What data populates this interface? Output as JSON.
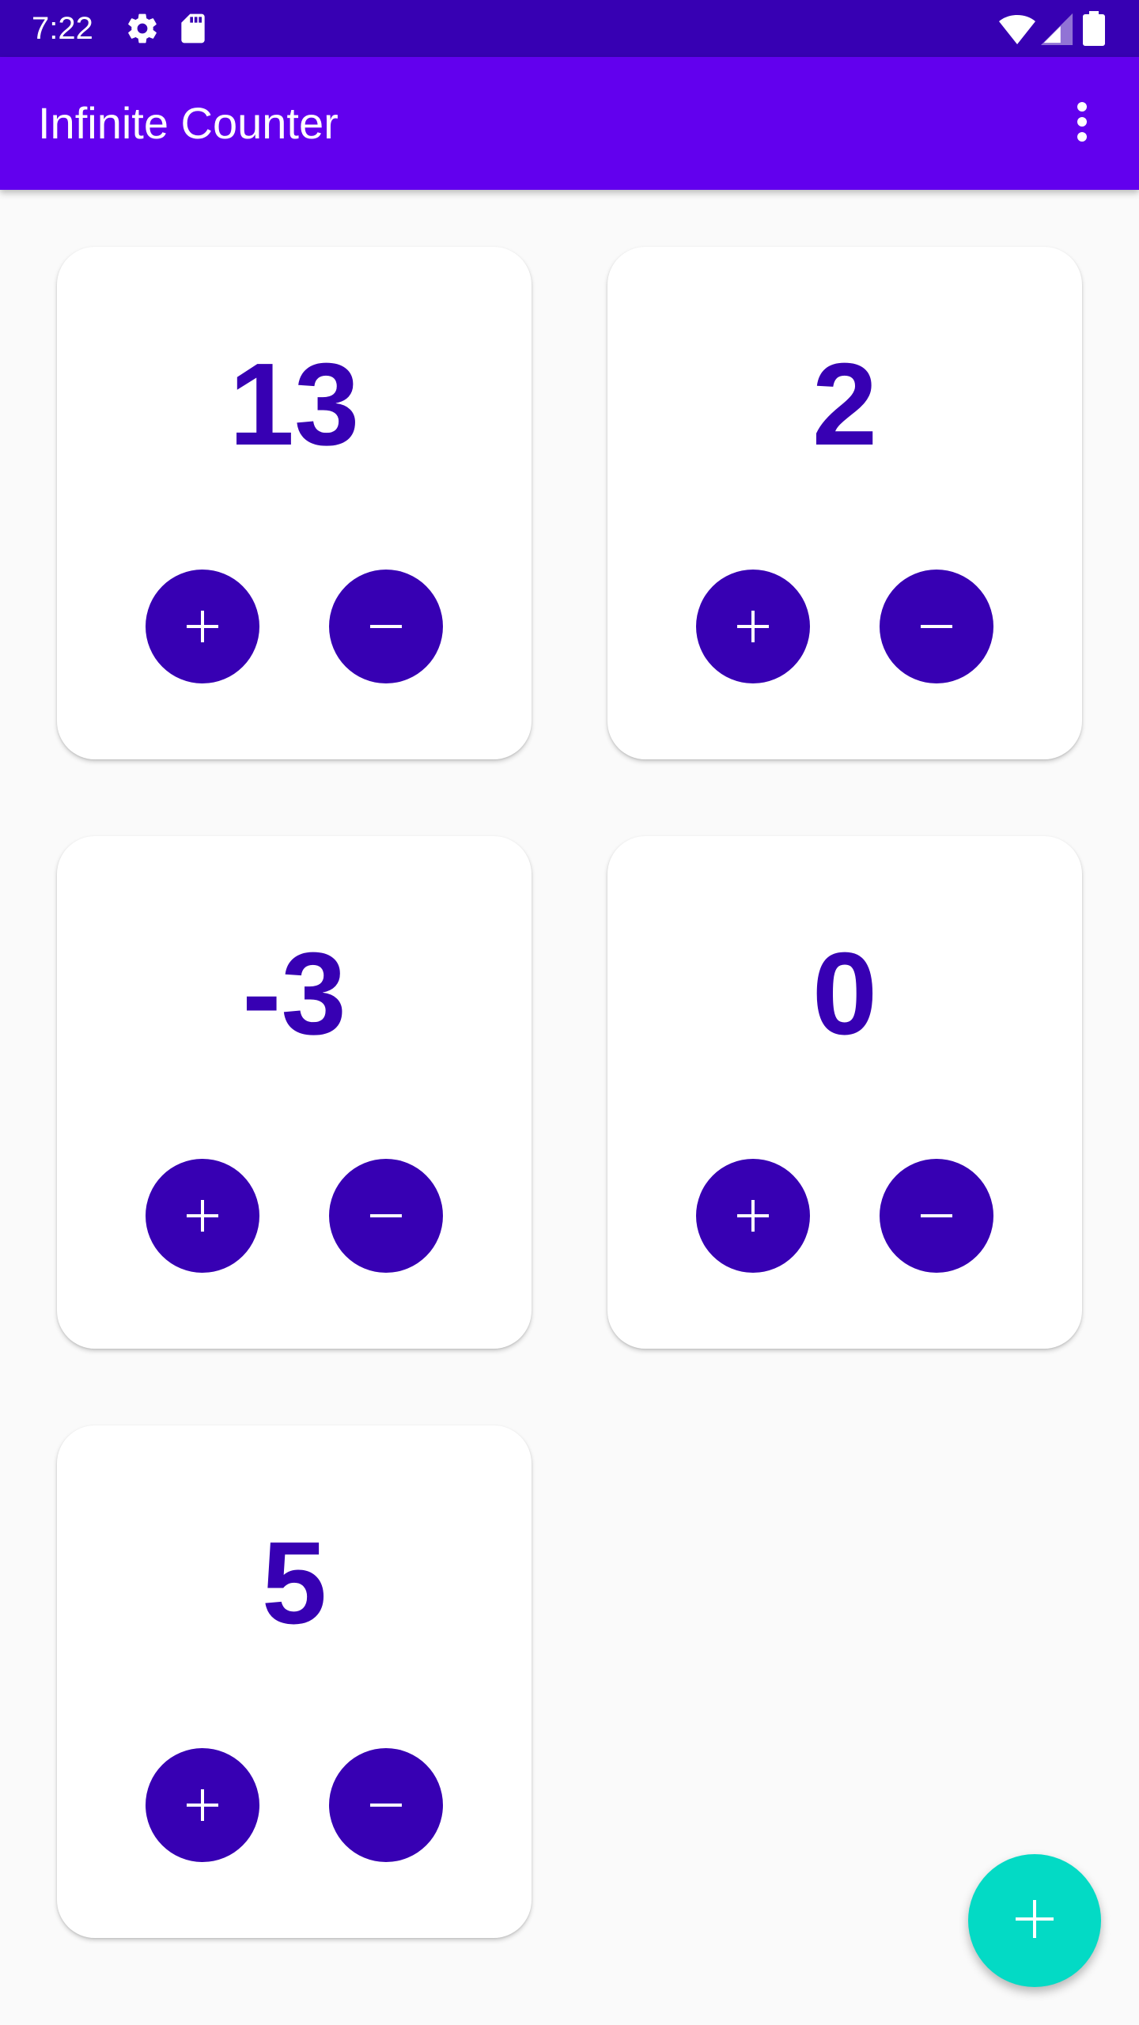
{
  "status_bar": {
    "time": "7:22",
    "icons": [
      "gear-icon",
      "sd-card-icon",
      "wifi-icon",
      "signal-icon",
      "battery-icon"
    ]
  },
  "app_bar": {
    "title": "Infinite Counter",
    "overflow_icon": "more-vert-icon"
  },
  "counters": [
    {
      "value": "13",
      "increment_icon": "plus-icon",
      "decrement_icon": "minus-icon"
    },
    {
      "value": "2",
      "increment_icon": "plus-icon",
      "decrement_icon": "minus-icon"
    },
    {
      "value": "-3",
      "increment_icon": "plus-icon",
      "decrement_icon": "minus-icon"
    },
    {
      "value": "0",
      "increment_icon": "plus-icon",
      "decrement_icon": "minus-icon"
    },
    {
      "value": "5",
      "increment_icon": "plus-icon",
      "decrement_icon": "minus-icon"
    }
  ],
  "fab": {
    "icon": "plus-icon"
  },
  "colors": {
    "status_bar": "#3700b3",
    "app_bar": "#6200ee",
    "counter_text": "#3700b3",
    "counter_button": "#3700b3",
    "fab": "#03dac5",
    "background": "#fafafa",
    "card": "#ffffff"
  }
}
